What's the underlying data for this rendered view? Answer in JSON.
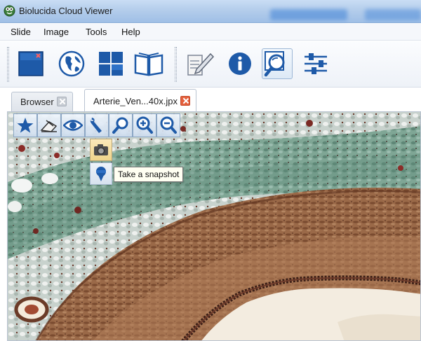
{
  "window": {
    "title": "Biolucida Cloud Viewer"
  },
  "menu": {
    "items": [
      "Slide",
      "Image",
      "Tools",
      "Help"
    ]
  },
  "toolbar": {
    "buttons": [
      "close-slide",
      "globe",
      "layout-grid",
      "open-book",
      "annotate",
      "info",
      "search",
      "settings-sliders"
    ],
    "active": "search"
  },
  "tabs": [
    {
      "label": "Browser",
      "active": false
    },
    {
      "label": "Arterie_Ven...40x.jpx",
      "active": true
    }
  ],
  "viewer_tools": {
    "buttons": [
      "star",
      "eraser",
      "eye",
      "wrench",
      "magnifier",
      "zoom-in",
      "zoom-out"
    ],
    "submenu": [
      "snapshot-camera",
      "pin"
    ],
    "tooltip": "Take a snapshot"
  },
  "colors": {
    "title_bar": "#b4cdeb",
    "accent_blue": "#1e5aa8",
    "close_tab": "#e4603c",
    "tissue_green": "#7aa38f",
    "tissue_brown": "#8a5a3c",
    "lumen": "#f3ece0"
  }
}
